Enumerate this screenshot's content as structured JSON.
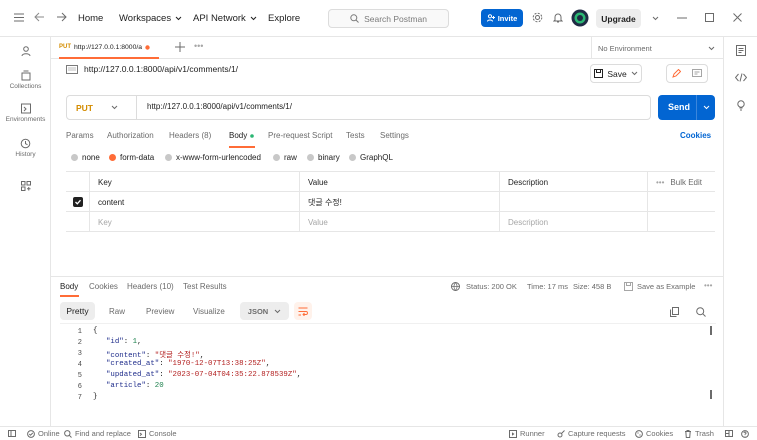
{
  "topbar": {
    "nav": {
      "home": "Home",
      "workspaces": "Workspaces",
      "api_network": "API Network",
      "explore": "Explore"
    },
    "search_placeholder": "Search Postman",
    "invite": "Invite",
    "upgrade": "Upgrade"
  },
  "sidebar": {
    "items": [
      {
        "label": "Collections",
        "icon": "collections-icon"
      },
      {
        "label": "Environments",
        "icon": "environments-icon"
      },
      {
        "label": "History",
        "icon": "history-icon"
      },
      {
        "label": "",
        "icon": "apps-icon"
      }
    ]
  },
  "tabs": {
    "active_method": "PUT",
    "active_title": "http://127.0.0.1:8000/a",
    "environment": "No Environment"
  },
  "request": {
    "title": "http://127.0.0.1:8000/api/v1/comments/1/",
    "save": "Save",
    "method": "PUT",
    "url": "http://127.0.0.1:8000/api/v1/comments/1/",
    "send": "Send",
    "tabs": {
      "params": "Params",
      "authorization": "Authorization",
      "headers": "Headers (8)",
      "body": "Body",
      "prerequest": "Pre-request Script",
      "tests": "Tests",
      "settings": "Settings",
      "cookies": "Cookies"
    },
    "body_types": [
      "none",
      "form-data",
      "x-www-form-urlencoded",
      "raw",
      "binary",
      "GraphQL"
    ],
    "body_type_selected": "form-data",
    "table": {
      "headers": {
        "key": "Key",
        "value": "Value",
        "description": "Description",
        "bulk_edit": "Bulk Edit"
      },
      "rows": [
        {
          "key": "content",
          "value": "댓글 수정!",
          "description": ""
        }
      ],
      "placeholder": {
        "key": "Key",
        "value": "Value",
        "description": "Description"
      }
    }
  },
  "response": {
    "tabs": {
      "body": "Body",
      "cookies": "Cookies",
      "headers": "Headers (10)",
      "test_results": "Test Results"
    },
    "status": "Status: 200 OK",
    "time": "Time: 17 ms",
    "size": "Size: 458 B",
    "save_example": "Save as Example",
    "views": {
      "pretty": "Pretty",
      "raw": "Raw",
      "preview": "Preview",
      "visualize": "Visualize"
    },
    "format": "JSON",
    "lines": {
      "n1": "1",
      "n2": "2",
      "n3": "3",
      "n4": "4",
      "n5": "5",
      "n6": "6",
      "n7": "7",
      "l1": "{",
      "id_key": "\"id\"",
      "id_val": "1",
      "content_key": "\"content\"",
      "content_val": "\"댓글 수정!\"",
      "created_key": "\"created_at\"",
      "created_val": "\"1970-12-07T13:38:25Z\"",
      "updated_key": "\"updated_at\"",
      "updated_val": "\"2023-07-04T04:35:22.878539Z\"",
      "article_key": "\"article\"",
      "article_val": "20",
      "l7": "}"
    }
  },
  "statusbar": {
    "online": "Online",
    "find_replace": "Find and replace",
    "console": "Console",
    "runner": "Runner",
    "capture": "Capture requests",
    "cookies": "Cookies",
    "trash": "Trash"
  },
  "colors": {
    "accent": "#ff6c37",
    "primary": "#0265d2",
    "put_method": "#d48c00"
  }
}
